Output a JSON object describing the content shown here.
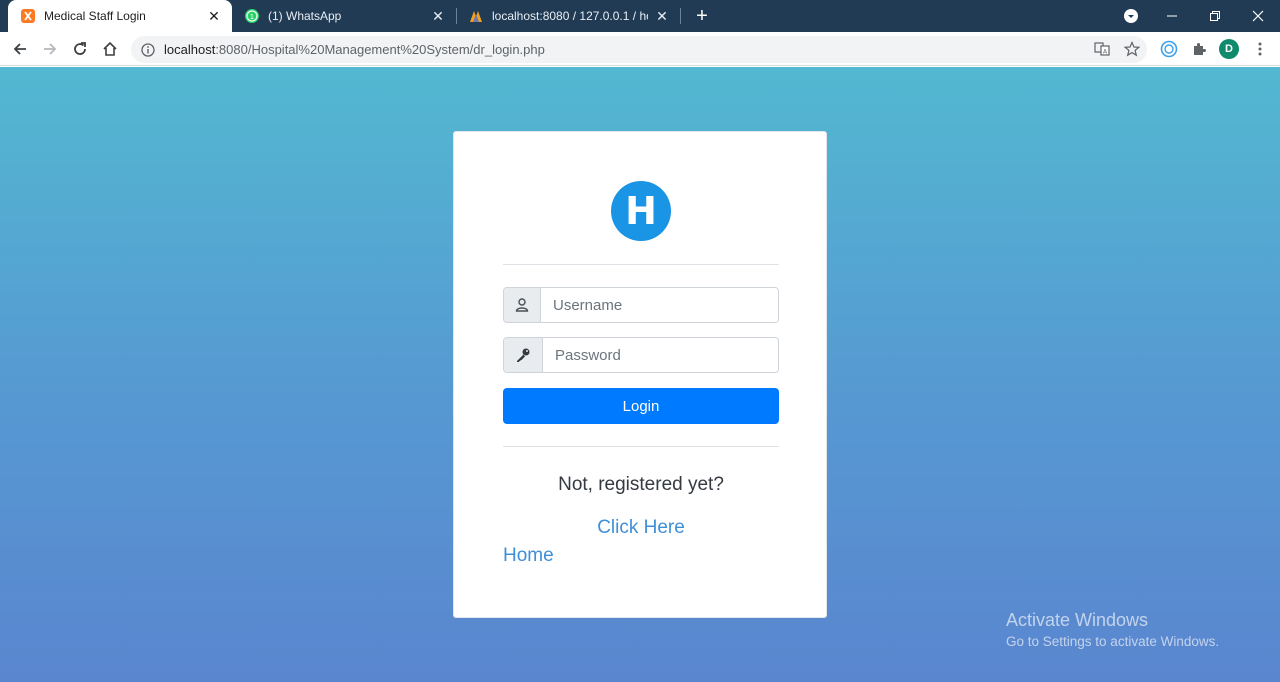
{
  "browser": {
    "tabs": [
      {
        "title": "Medical Staff Login",
        "active": true,
        "favicon": "xampp-icon"
      },
      {
        "title": "(1) WhatsApp",
        "active": false,
        "favicon": "whatsapp-icon"
      },
      {
        "title": "localhost:8080 / 127.0.0.1 / hospi",
        "active": false,
        "favicon": "phpmyadmin-icon"
      }
    ],
    "new_tab_label": "+",
    "address": {
      "host": "localhost",
      "path": ":8080/Hospital%20Management%20System/dr_login.php"
    },
    "profile_initial": "D",
    "colors": {
      "tabstrip": "#223b54",
      "avatar": "#0f8a6d"
    }
  },
  "login": {
    "logo_letter": "H",
    "username_placeholder": "Username",
    "password_placeholder": "Password",
    "login_button": "Login",
    "not_registered": "Not, registered yet?",
    "click_here": "Click Here",
    "home": "Home",
    "colors": {
      "primary": "#007bff",
      "logo": "#1a95e6",
      "link": "#3f8fd8"
    }
  },
  "watermark": {
    "line1": "Activate Windows",
    "line2": "Go to Settings to activate Windows."
  }
}
